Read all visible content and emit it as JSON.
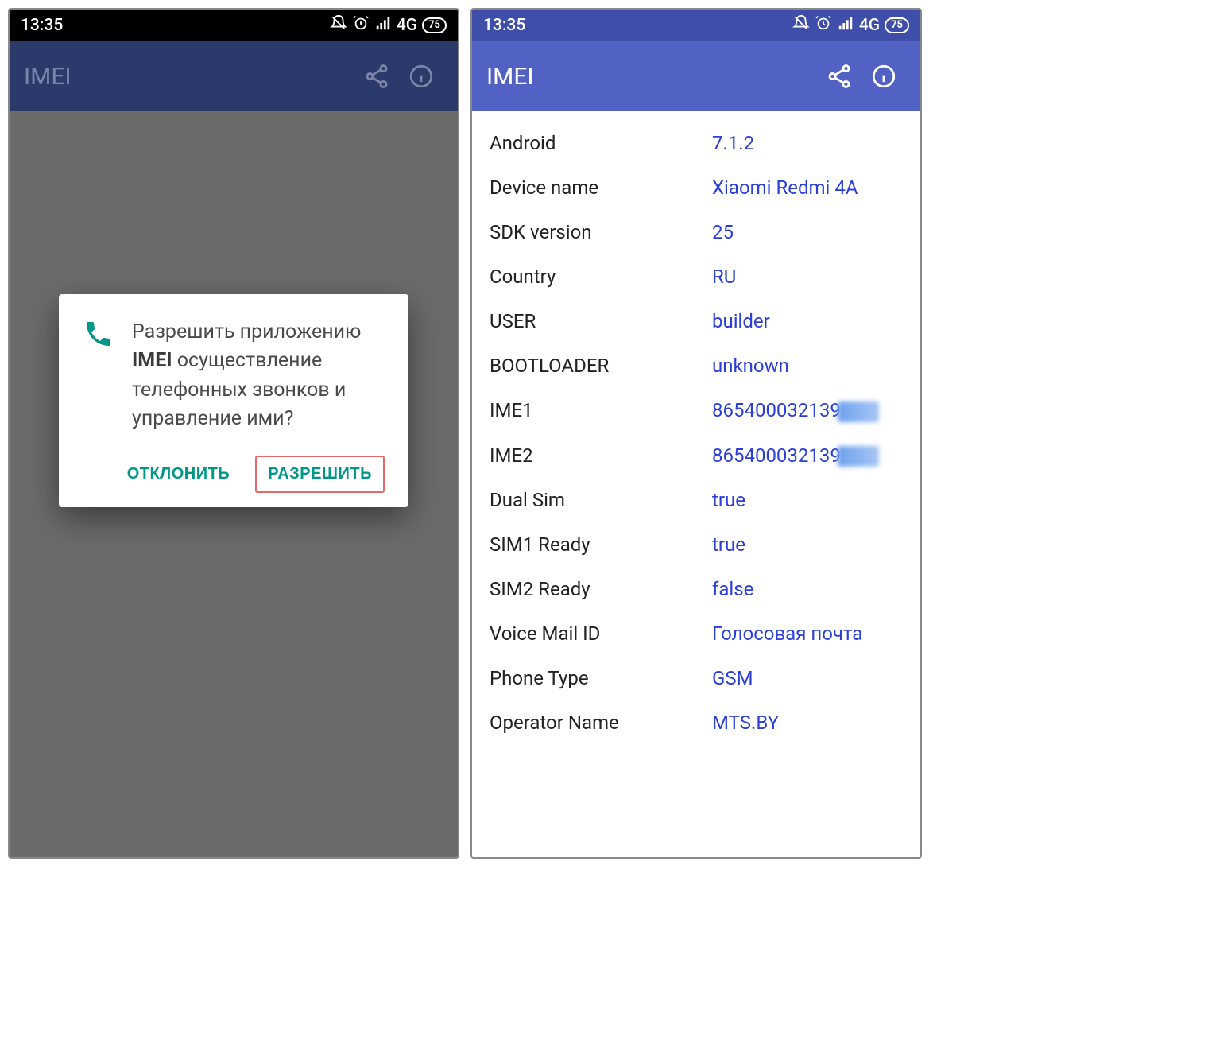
{
  "status": {
    "time": "13:35",
    "network_label": "4G",
    "battery_text": "75"
  },
  "appbar": {
    "title": "IMEI"
  },
  "dialog": {
    "msg_prefix": "Разрешить приложению ",
    "msg_app": "IMEI",
    "msg_suffix": " осуществление телефонных звонков и управление ими?",
    "deny": "ОТКЛОНИТЬ",
    "allow": "РАЗРЕШИТЬ"
  },
  "info": {
    "rows": [
      {
        "k": "Android",
        "v": "7.1.2"
      },
      {
        "k": "Device name",
        "v": "Xiaomi Redmi 4A"
      },
      {
        "k": "SDK version",
        "v": "25"
      },
      {
        "k": "Country",
        "v": "RU"
      },
      {
        "k": "USER",
        "v": "builder"
      },
      {
        "k": "BOOTLOADER",
        "v": "unknown"
      },
      {
        "k": "IME1",
        "v": "865400032139",
        "blurred_tail": true
      },
      {
        "k": "IME2",
        "v": "865400032139",
        "blurred_tail": true
      },
      {
        "k": "Dual Sim",
        "v": "true"
      },
      {
        "k": "SIM1 Ready",
        "v": "true"
      },
      {
        "k": "SIM2 Ready",
        "v": "false"
      },
      {
        "k": "Voice Mail ID",
        "v": "Голосовая почта"
      },
      {
        "k": "Phone Type",
        "v": "GSM"
      },
      {
        "k": "Operator Name",
        "v": "MTS.BY"
      }
    ]
  }
}
